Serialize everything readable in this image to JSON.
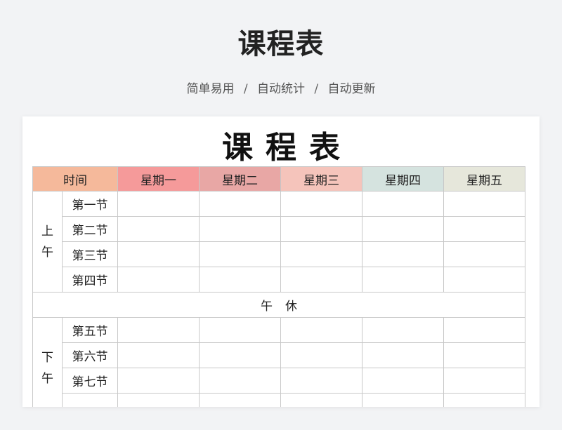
{
  "header": {
    "title": "课程表",
    "subtitle_parts": [
      "简单易用",
      "自动统计",
      "自动更新"
    ],
    "separator": "/"
  },
  "sheet": {
    "title": "课程表",
    "columns": [
      {
        "label": "时间",
        "color": "#f5b99b"
      },
      {
        "label": "星期一",
        "color": "#f59a9a"
      },
      {
        "label": "星期二",
        "color": "#e8a7a5"
      },
      {
        "label": "星期三",
        "color": "#f5c4bb"
      },
      {
        "label": "星期四",
        "color": "#d5e3df"
      },
      {
        "label": "星期五",
        "color": "#e6e7db"
      }
    ],
    "morning": {
      "label_chars": [
        "上",
        "午"
      ],
      "slots": [
        "第一节",
        "第二节",
        "第三节",
        "第四节"
      ]
    },
    "noon_break": "午休",
    "afternoon": {
      "label_chars": [
        "下",
        "午"
      ],
      "slots": [
        "第五节",
        "第六节",
        "第七节",
        ""
      ]
    }
  }
}
